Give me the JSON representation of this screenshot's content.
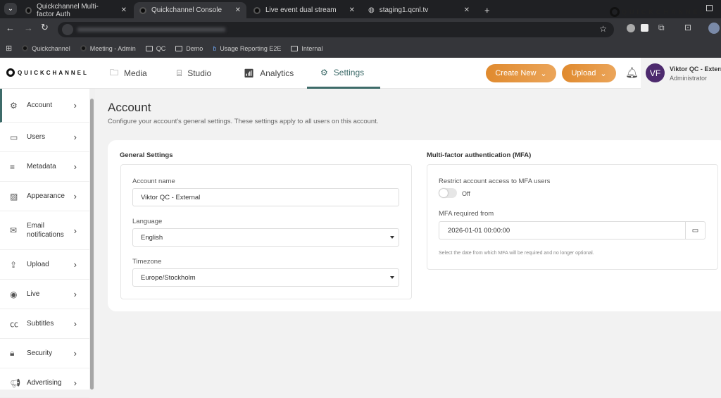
{
  "browser": {
    "tabs": [
      "Quickchannel Multi-factor Auth",
      "Quickchannel Console",
      "Live event dual stream",
      "staging1.qcnl.tv"
    ],
    "bookmarks": [
      "Quickchannel",
      "Meeting - Admin",
      "QC",
      "Demo",
      "Usage Reporting E2E",
      "Internal"
    ],
    "window_brand": "QUICKCHANNEL"
  },
  "app": {
    "logo": "QUICKCHANNEL",
    "nav": [
      "Media",
      "Studio",
      "Analytics",
      "Settings"
    ],
    "create_new": "Create New",
    "upload": "Upload",
    "user": {
      "initials": "VF",
      "name": "Viktor QC - External",
      "role": "Administrator"
    },
    "accent": "#3d6b69",
    "button_color": "#e59440"
  },
  "sidebar": [
    "Account",
    "Users",
    "Metadata",
    "Appearance",
    "Email notifications",
    "Upload",
    "Live",
    "Subtitles",
    "Security",
    "Advertising"
  ],
  "page": {
    "title": "Account",
    "subtitle": "Configure your account's general settings. These settings apply to all users on this account.",
    "general": {
      "heading": "General Settings",
      "account_name_label": "Account name",
      "account_name": "Viktor QC - External",
      "language_label": "Language",
      "language": "English",
      "timezone_label": "Timezone",
      "timezone": "Europe/Stockholm"
    },
    "mfa": {
      "heading": "Multi-factor authentication (MFA)",
      "restrict_label": "Restrict account access to MFA users",
      "toggle_state": "Off",
      "required_from_label": "MFA required from",
      "required_from": "2026-01-01 00:00:00",
      "help": "Select the date from which MFA will be required and no longer optional."
    }
  }
}
